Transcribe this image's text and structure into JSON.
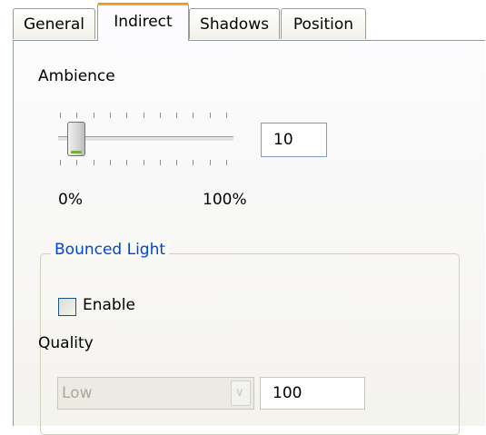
{
  "tabs": [
    {
      "label": "General",
      "active": false
    },
    {
      "label": "Indirect",
      "active": true
    },
    {
      "label": "Shadows",
      "active": false
    },
    {
      "label": "Position",
      "active": false
    }
  ],
  "ambience": {
    "label": "Ambience",
    "slider_value_percent": 10,
    "min_label": "0%",
    "max_label": "100%",
    "value_field": "10"
  },
  "bounced_light": {
    "title": "Bounced Light",
    "enable_label": "Enable",
    "enable_checked": false,
    "quality_label": "Quality",
    "quality_selected": "Low",
    "quality_value": "100"
  },
  "colors": {
    "active_tab_accent": "#f5a623",
    "group_title": "#0046d5",
    "disabled_text": "#aca899"
  }
}
